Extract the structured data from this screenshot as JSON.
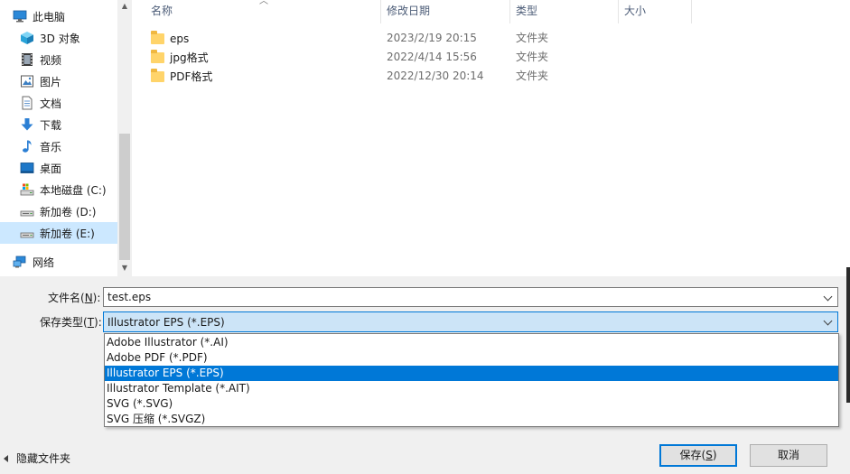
{
  "nav": {
    "items": [
      {
        "label": "此电脑",
        "icon": "computer-icon",
        "selected": false
      },
      {
        "label": "3D 对象",
        "icon": "3d-objects-icon",
        "selected": false
      },
      {
        "label": "视频",
        "icon": "video-icon",
        "selected": false
      },
      {
        "label": "图片",
        "icon": "pictures-icon",
        "selected": false
      },
      {
        "label": "文档",
        "icon": "documents-icon",
        "selected": false
      },
      {
        "label": "下载",
        "icon": "download-icon",
        "selected": false
      },
      {
        "label": "音乐",
        "icon": "music-icon",
        "selected": false
      },
      {
        "label": "桌面",
        "icon": "desktop-icon",
        "selected": false
      },
      {
        "label": "本地磁盘 (C:)",
        "icon": "system-drive-icon",
        "selected": false
      },
      {
        "label": "新加卷 (D:)",
        "icon": "drive-icon",
        "selected": false
      },
      {
        "label": "新加卷 (E:)",
        "icon": "drive-icon",
        "selected": true
      },
      {
        "label": "网络",
        "icon": "network-icon",
        "selected": false
      }
    ]
  },
  "file_list": {
    "columns": [
      "名称",
      "修改日期",
      "类型",
      "大小"
    ],
    "rows": [
      {
        "name": "eps",
        "modified": "2023/2/19 20:15",
        "type": "文件夹",
        "size": ""
      },
      {
        "name": "jpg格式",
        "modified": "2022/4/14 15:56",
        "type": "文件夹",
        "size": ""
      },
      {
        "name": "PDF格式",
        "modified": "2022/12/30 20:14",
        "type": "文件夹",
        "size": ""
      }
    ]
  },
  "form": {
    "filename_label": "文件名(",
    "filename_key": "N",
    "filename_label_end": "):",
    "filename_value": "test.eps",
    "savetype_label": "保存类型(",
    "savetype_key": "T",
    "savetype_label_end": "):",
    "savetype_value": "Illustrator EPS (*.EPS)",
    "savetype_options": [
      "Adobe Illustrator (*.AI)",
      "Adobe PDF (*.PDF)",
      "Illustrator EPS (*.EPS)",
      "Illustrator Template (*.AIT)",
      "SVG (*.SVG)",
      "SVG 压缩 (*.SVGZ)"
    ],
    "savetype_selected_index": 2
  },
  "footer": {
    "hide_folders_label": "隐藏文件夹",
    "save_label": "保存(",
    "save_key": "S",
    "save_label_end": ")",
    "cancel_label": "取消"
  },
  "colors": {
    "selection": "#0078d7",
    "nav_selected": "#cce8ff",
    "folder": "#ffd46a"
  }
}
